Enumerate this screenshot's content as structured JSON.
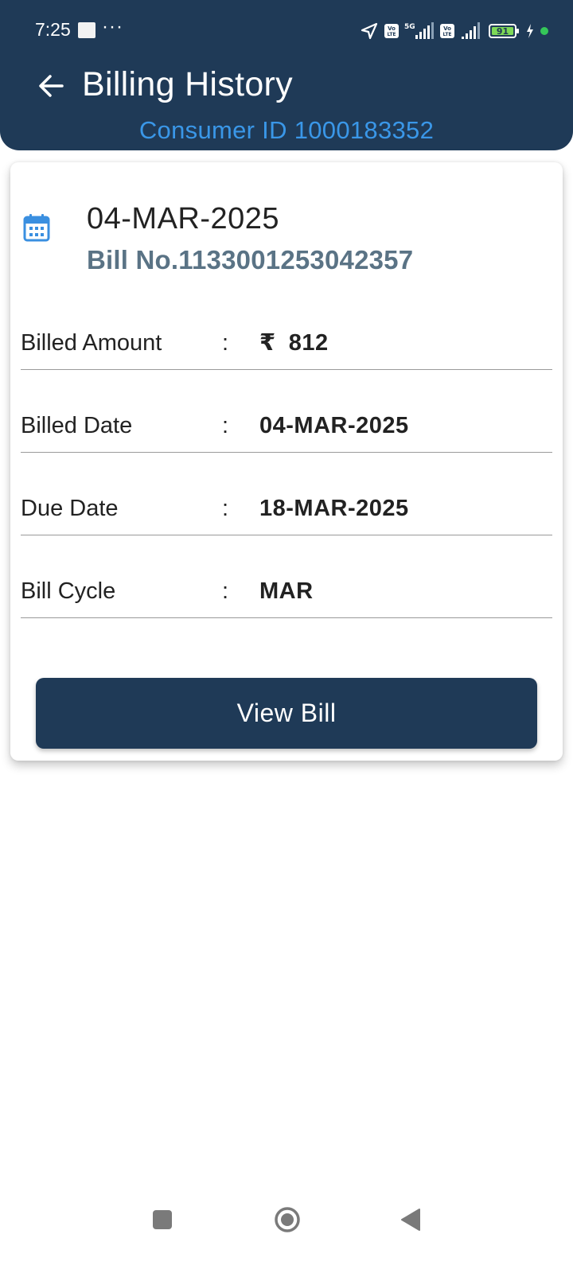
{
  "status_bar": {
    "time": "7:25",
    "battery_level": "91",
    "network": "5G",
    "icons": [
      "location-arrow-icon",
      "volte-icon",
      "signal-icon",
      "volte-icon",
      "signal-icon",
      "battery-icon",
      "charging-icon",
      "green-dot-icon"
    ]
  },
  "header": {
    "title": "Billing History",
    "consumer_id": "Consumer ID 1000183352",
    "back_icon": "arrow-left-icon",
    "background_color": "#1f3a57",
    "accent_color": "#3a97e8"
  },
  "bill_card": {
    "icon": "calendar-icon",
    "date": "04-MAR-2025",
    "bill_number": "Bill No.1133001253042357",
    "rows": [
      {
        "label": "Billed Amount",
        "separator": ":",
        "currency": "₹",
        "value": "812"
      },
      {
        "label": "Billed Date",
        "separator": ":",
        "value": "04-MAR-2025"
      },
      {
        "label": "Due Date",
        "separator": ":",
        "value": "18-MAR-2025"
      },
      {
        "label": "Bill Cycle",
        "separator": ":",
        "value": "MAR"
      }
    ],
    "button_label": "View Bill"
  },
  "nav_bar": {
    "items": [
      "recents-square-icon",
      "home-circle-icon",
      "back-triangle-icon"
    ]
  }
}
